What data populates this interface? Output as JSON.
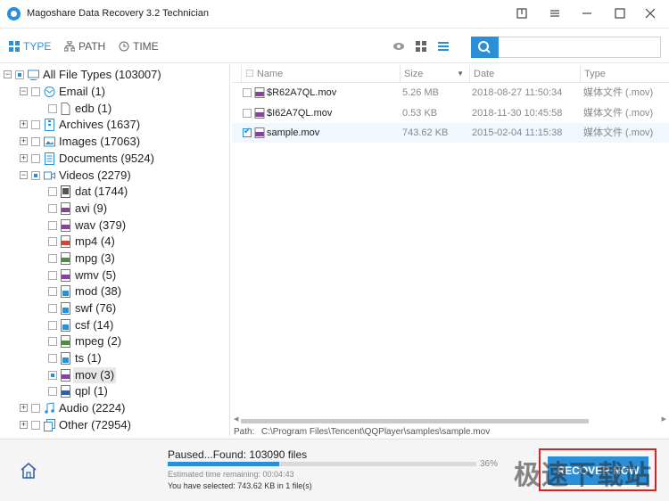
{
  "window": {
    "title": "Magoshare Data Recovery 3.2 Technician"
  },
  "tabs": [
    {
      "label": "TYPE",
      "icon": "grid-icon"
    },
    {
      "label": "PATH",
      "icon": "sitemap-icon"
    },
    {
      "label": "TIME",
      "icon": "clock-icon"
    }
  ],
  "search": {
    "placeholder": ""
  },
  "tree": {
    "root": "All File Types (103007)",
    "email": "Email (1)",
    "edb": "edb (1)",
    "archives": "Archives (1637)",
    "images": "Images (17063)",
    "documents": "Documents (9524)",
    "videos": "Videos (2279)",
    "video_types": [
      "dat (1744)",
      "avi (9)",
      "wav (379)",
      "mp4 (4)",
      "mpg (3)",
      "wmv (5)",
      "mod (38)",
      "swf (76)",
      "csf (14)",
      "mpeg (2)",
      "ts (1)",
      "mov (3)",
      "qpl (1)"
    ],
    "audio": "Audio (2224)",
    "other": "Other (72954)"
  },
  "table": {
    "columns": [
      "Name",
      "Size",
      "Date",
      "Type"
    ],
    "rows": [
      {
        "name": "$R62A7QL.mov",
        "size": "5.26 MB",
        "date": "2018-08-27 11:50:34",
        "type": "媒体文件 (.mov)",
        "checked": false
      },
      {
        "name": "$I62A7QL.mov",
        "size": "0.53 KB",
        "date": "2018-11-30 10:45:58",
        "type": "媒体文件 (.mov)",
        "checked": false
      },
      {
        "name": "sample.mov",
        "size": "743.62 KB",
        "date": "2015-02-04 11:15:38",
        "type": "媒体文件 (.mov)",
        "checked": true
      }
    ]
  },
  "path_bar": {
    "label": "Path:",
    "value": "C:\\Program Files\\Tencent\\QQPlayer\\samples\\sample.mov"
  },
  "status": {
    "main": "Paused...Found: 103090 files",
    "progress_percent": 36,
    "progress_label": "36%",
    "eta": "Estimated time remaining:     00:04:43",
    "selected": "You have selected: 743.62 KB in 1 file(s)"
  },
  "recover_button": "RECOVER NOW",
  "watermark": "极速下载站",
  "colors": {
    "accent": "#2b8fd8",
    "highlight_border": "#e02020"
  }
}
